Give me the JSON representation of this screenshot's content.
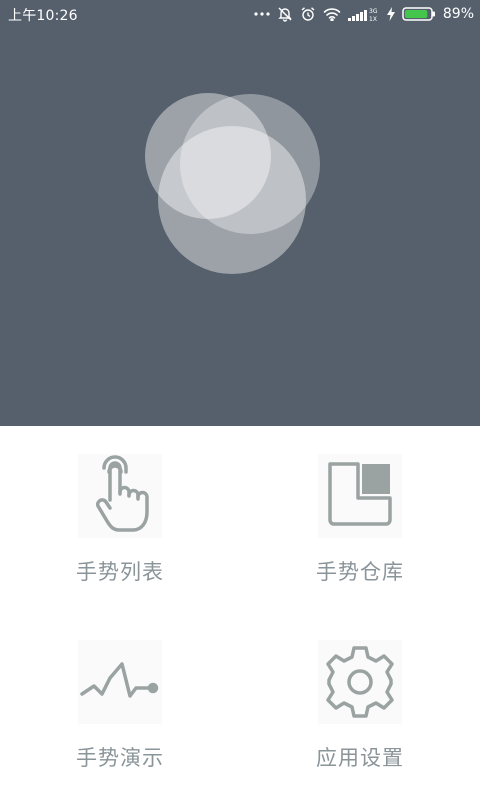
{
  "status_bar": {
    "time": "上午10:26",
    "battery_percent": "89%",
    "network_type_top": "3G",
    "network_type_bottom": "1X",
    "battery_level": 0.89,
    "icons": [
      "more-dots-icon",
      "mute-icon",
      "alarm-icon",
      "wifi-icon",
      "signal-icon",
      "charging-icon",
      "battery-icon"
    ]
  },
  "hero": {
    "background_color": "#56606c",
    "logo_icon": "overlapping-circles-logo"
  },
  "menu": {
    "items": [
      {
        "label": "手势列表",
        "icon": "tap-hand-icon"
      },
      {
        "label": "手势仓库",
        "icon": "gesture-repository-icon"
      },
      {
        "label": "手势演示",
        "icon": "gesture-waveform-icon"
      },
      {
        "label": "应用设置",
        "icon": "gear-icon"
      }
    ],
    "icon_color": "#9aa2a2",
    "label_color": "#8a9499"
  }
}
